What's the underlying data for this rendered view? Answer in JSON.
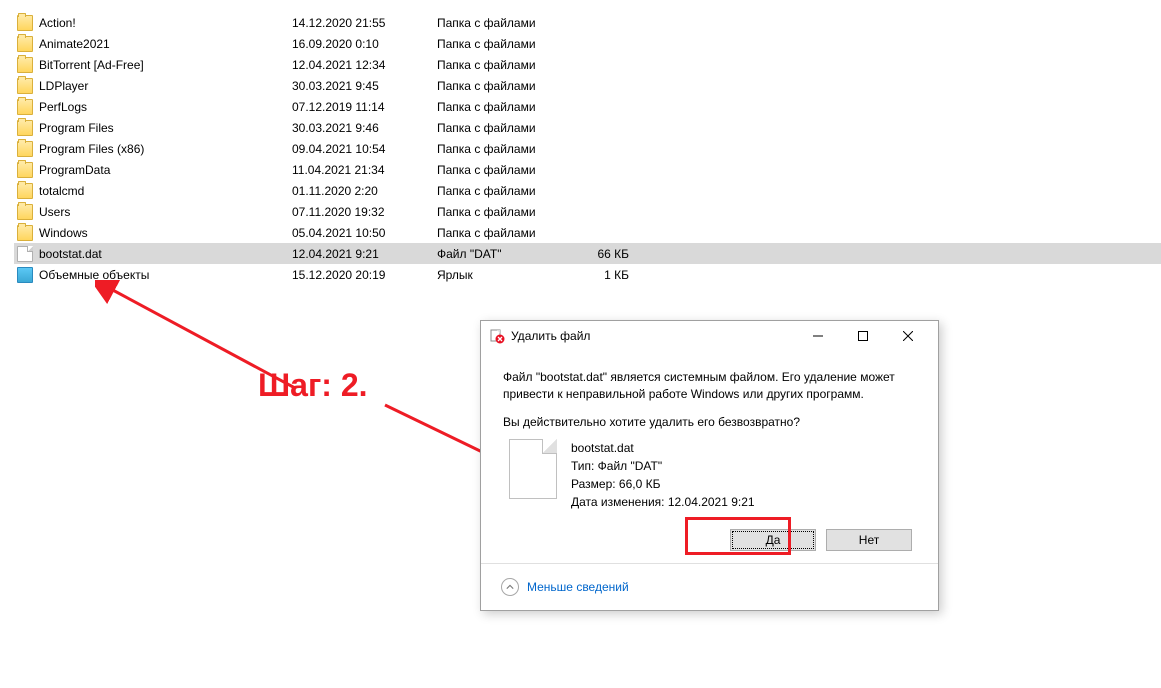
{
  "files": [
    {
      "name": "Action!",
      "date": "14.12.2020 21:55",
      "type": "Папка с файлами",
      "size": "",
      "icon": "folder"
    },
    {
      "name": "Animate2021",
      "date": "16.09.2020 0:10",
      "type": "Папка с файлами",
      "size": "",
      "icon": "folder"
    },
    {
      "name": "BitTorrent [Ad-Free]",
      "date": "12.04.2021 12:34",
      "type": "Папка с файлами",
      "size": "",
      "icon": "folder"
    },
    {
      "name": "LDPlayer",
      "date": "30.03.2021 9:45",
      "type": "Папка с файлами",
      "size": "",
      "icon": "folder"
    },
    {
      "name": "PerfLogs",
      "date": "07.12.2019 11:14",
      "type": "Папка с файлами",
      "size": "",
      "icon": "folder"
    },
    {
      "name": "Program Files",
      "date": "30.03.2021 9:46",
      "type": "Папка с файлами",
      "size": "",
      "icon": "folder"
    },
    {
      "name": "Program Files (x86)",
      "date": "09.04.2021 10:54",
      "type": "Папка с файлами",
      "size": "",
      "icon": "folder"
    },
    {
      "name": "ProgramData",
      "date": "11.04.2021 21:34",
      "type": "Папка с файлами",
      "size": "",
      "icon": "folder"
    },
    {
      "name": "totalcmd",
      "date": "01.11.2020 2:20",
      "type": "Папка с файлами",
      "size": "",
      "icon": "folder"
    },
    {
      "name": "Users",
      "date": "07.11.2020 19:32",
      "type": "Папка с файлами",
      "size": "",
      "icon": "folder"
    },
    {
      "name": "Windows",
      "date": "05.04.2021 10:50",
      "type": "Папка с файлами",
      "size": "",
      "icon": "folder"
    },
    {
      "name": "bootstat.dat",
      "date": "12.04.2021 9:21",
      "type": "Файл \"DAT\"",
      "size": "66 КБ",
      "icon": "file",
      "selected": true
    },
    {
      "name": "Объемные объекты",
      "date": "15.12.2020 20:19",
      "type": "Ярлык",
      "size": "1 КБ",
      "icon": "shortcut"
    }
  ],
  "annotation": {
    "step": "Шаг: 2."
  },
  "dialog": {
    "title": "Удалить файл",
    "message": "Файл \"bootstat.dat\" является системным файлом. Его удаление может привести к неправильной работе Windows или других программ.",
    "question": "Вы действительно хотите удалить его безвозвратно?",
    "file": {
      "name": "bootstat.dat",
      "type_label": "Тип: Файл \"DAT\"",
      "size_label": "Размер: 66,0 КБ",
      "date_label": "Дата изменения: 12.04.2021 9:21"
    },
    "buttons": {
      "yes": "Да",
      "no": "Нет"
    },
    "footer": "Меньше сведений"
  }
}
